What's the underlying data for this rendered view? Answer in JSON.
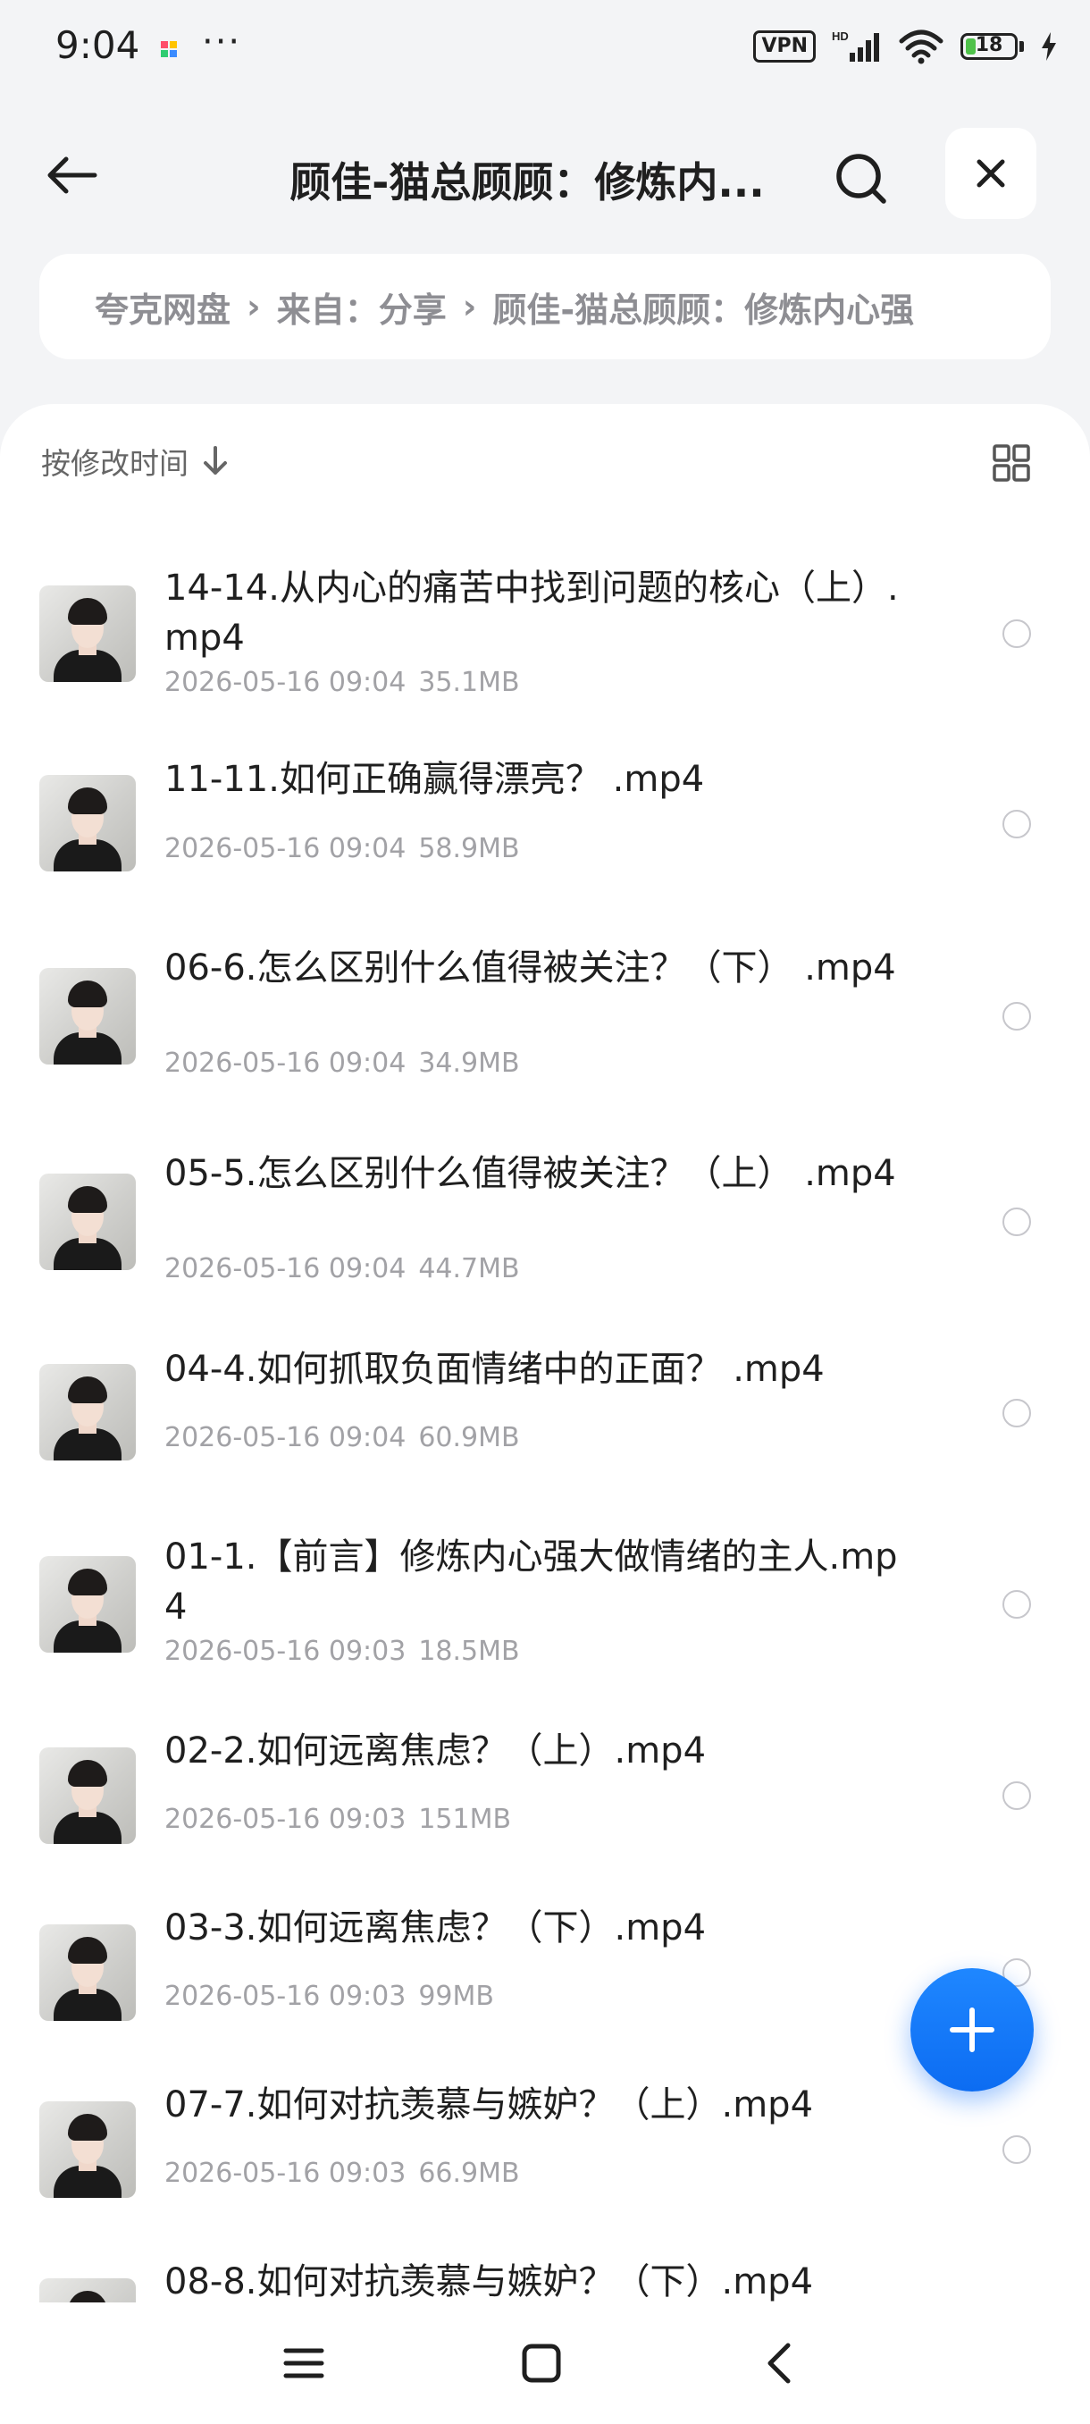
{
  "status_bar": {
    "time": "9:04",
    "more": "···",
    "vpn": "VPN",
    "network": "HD",
    "battery": "18",
    "battery_color": "#4fc24a"
  },
  "header": {
    "title": "顾佳-猫总顾顾：修炼内...",
    "back_icon": "back-arrow-icon",
    "search_icon": "search-icon",
    "close_icon": "close-icon"
  },
  "breadcrumb": [
    "夸克网盘",
    "来自：分享",
    "顾佳-猫总顾顾：修炼内心强"
  ],
  "sort": {
    "label": "按修改时间",
    "direction_icon": "arrow-down-icon",
    "view_icon": "grid-view-icon"
  },
  "files": [
    {
      "name": "14-14.从内心的痛苦中找到问题的核心（上）.mp4",
      "date": "2026-05-16 09:04",
      "size": "35.1MB"
    },
    {
      "name": "11-11.如何正确赢得漂亮？ .mp4",
      "date": "2026-05-16 09:04",
      "size": "58.9MB"
    },
    {
      "name": "06-6.怎么区别什么值得被关注？（下） .mp4",
      "date": "2026-05-16 09:04",
      "size": "34.9MB"
    },
    {
      "name": "05-5.怎么区别什么值得被关注？（上） .mp4",
      "date": "2026-05-16 09:04",
      "size": "44.7MB"
    },
    {
      "name": "04-4.如何抓取负面情绪中的正面？ .mp4",
      "date": "2026-05-16 09:04",
      "size": "60.9MB"
    },
    {
      "name": "01-1.【前言】修炼内心强大做情绪的主人.mp4",
      "date": "2026-05-16 09:03",
      "size": "18.5MB"
    },
    {
      "name": "02-2.如何远离焦虑？（上）.mp4",
      "date": "2026-05-16 09:03",
      "size": "151MB"
    },
    {
      "name": "03-3.如何远离焦虑？（下）.mp4",
      "date": "2026-05-16 09:03",
      "size": "99MB"
    },
    {
      "name": "07-7.如何对抗羡慕与嫉妒？（上）.mp4",
      "date": "2026-05-16 09:03",
      "size": "66.9MB"
    },
    {
      "name": "08-8.如何对抗羡慕与嫉妒？（下）.mp4",
      "date": "",
      "size": ""
    }
  ],
  "fab": {
    "icon": "plus-icon",
    "color": "#1f87ff"
  },
  "nav": {
    "menu_icon": "menu-icon",
    "home_icon": "home-icon",
    "back_icon": "nav-back-icon"
  }
}
